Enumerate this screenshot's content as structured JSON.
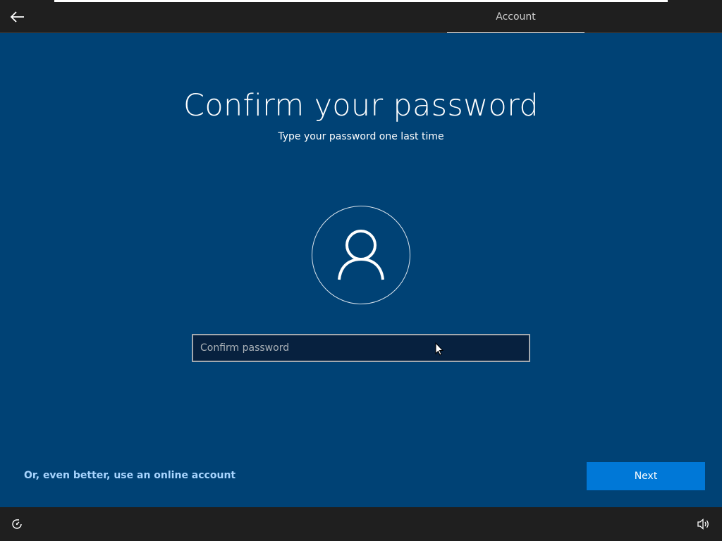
{
  "header": {
    "tab_label": "Account"
  },
  "main": {
    "title": "Confirm your password",
    "subtitle": "Type your password one last time",
    "password_placeholder": "Confirm password",
    "password_value": "",
    "online_account_link": "Or, even better, use an online account",
    "next_label": "Next"
  },
  "icons": {
    "back": "back-arrow-icon",
    "avatar": "user-icon",
    "accessibility": "ease-of-access-icon",
    "volume": "volume-icon",
    "cursor": "mouse-pointer-icon"
  },
  "colors": {
    "background": "#004275",
    "topbar": "#1f1f1f",
    "accent_button": "#0078d7",
    "link": "#a8d5ff",
    "field_background": "#07213f"
  }
}
